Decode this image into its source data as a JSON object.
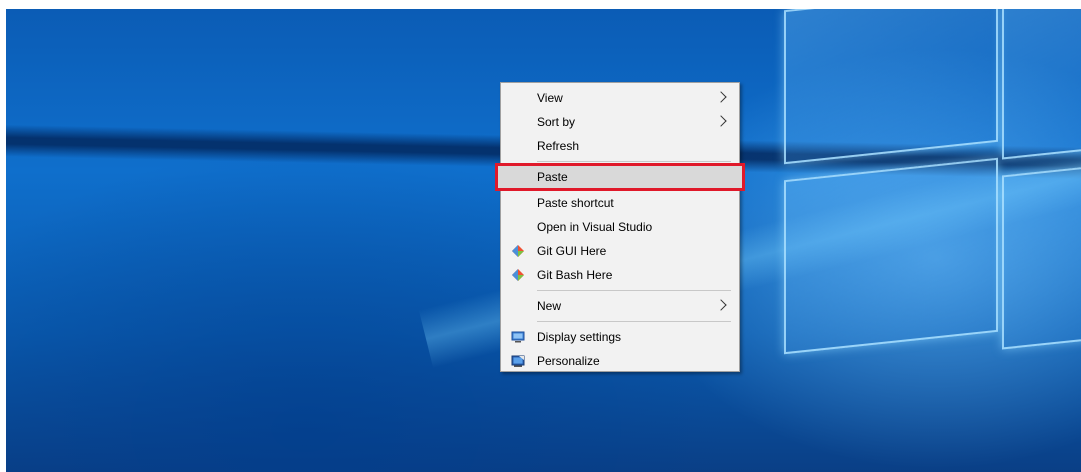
{
  "context_menu": {
    "items": [
      {
        "label": "View",
        "has_submenu": true
      },
      {
        "label": "Sort by",
        "has_submenu": true
      },
      {
        "label": "Refresh"
      },
      {
        "label": "Paste",
        "highlighted": true
      },
      {
        "label": "Paste shortcut"
      },
      {
        "label": "Open in Visual Studio"
      },
      {
        "label": "Git GUI Here",
        "icon": "git-icon"
      },
      {
        "label": "Git Bash Here",
        "icon": "git-icon"
      },
      {
        "label": "New",
        "has_submenu": true
      },
      {
        "label": "Display settings",
        "icon": "display-icon"
      },
      {
        "label": "Personalize",
        "icon": "personalize-icon"
      }
    ],
    "highlight_color": "#e0192a"
  }
}
